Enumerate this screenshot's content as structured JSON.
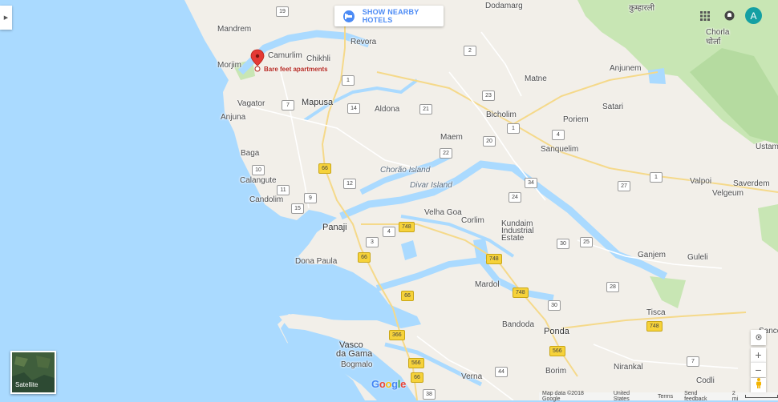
{
  "toolbar": {
    "hotel_button_label": "SHOW NEARBY HOTELS",
    "hotel_icon": "bed-icon"
  },
  "account": {
    "avatar_letter": "A",
    "apps_icon": "apps-grid-icon",
    "notifications_icon": "notifications-icon"
  },
  "layer_toggle": {
    "label": "Satellite"
  },
  "place_marker": {
    "label": "Bare feet apartments",
    "icon": "map-pin-icon"
  },
  "map_labels": {
    "dodamarg": "Dodamarg",
    "mandrem": "Mandrem",
    "morjim": "Morjim",
    "camurlim": "Camurlim",
    "chikhli": "Chikhli",
    "revora": "Revora",
    "matne": "Matne",
    "anjunem": "Anjunem",
    "chorla": "Chorla",
    "chorla_local": "चोर्ला",
    "kumbharli": "कुम्हारली",
    "vagator": "Vagator",
    "anjuna": "Anjuna",
    "mapusa": "Mapusa",
    "aldona": "Aldona",
    "bicholim": "Bicholim",
    "satari": "Satari",
    "poriem": "Poriem",
    "ustam": "Ustam",
    "baga": "Baga",
    "calangute": "Calangute",
    "candolim": "Candolim",
    "maem": "Maem",
    "sanquelim": "Sanquelim",
    "chorao_island": "Chorão Island",
    "divar_island": "Divar Island",
    "valpoi": "Valpoi",
    "saverdem": "Saverdem",
    "velgeum": "Velgeum",
    "panaji": "Panaji",
    "velha_goa": "Velha Goa",
    "corlim": "Corlim",
    "kundaim": "Kundaim",
    "industrial": "Industrial",
    "estate": "Estate",
    "dona_paula": "Dona Paula",
    "ganjem": "Ganjem",
    "guleli": "Guleli",
    "mardol": "Mardol",
    "tisca": "Tisca",
    "bandoda": "Bandoda",
    "ponda": "Ponda",
    "vasco": "Vasco",
    "da_gama": "da Gama",
    "bogmalo": "Bogmalo",
    "verna": "Verna",
    "borim": "Borim",
    "nirankal": "Nirankal",
    "codli": "Codli",
    "sanco": "Sanco"
  },
  "route_shields": {
    "s19": "19",
    "s2": "2",
    "s1a": "1",
    "s1b": "1",
    "s1c": "1",
    "s7": "7",
    "s14": "14",
    "s21": "21",
    "s23": "23",
    "s20": "20",
    "s4": "4",
    "s22": "22",
    "s10": "10",
    "s12": "12",
    "s11": "11",
    "s9": "9",
    "s15": "15",
    "s34": "34",
    "s24": "24",
    "s27": "27",
    "s4b": "4",
    "s3": "3",
    "s30a": "30",
    "s25": "25",
    "s30b": "30",
    "s28": "28",
    "s44": "44",
    "s38": "38",
    "s66a": "66",
    "s66b": "66",
    "s66c": "66",
    "s66d": "66",
    "s748a": "748",
    "s748b": "748",
    "s748c": "748",
    "s748d": "748",
    "s566a": "566",
    "s566b": "566",
    "s366": "366",
    "s7b": "7"
  },
  "footer": {
    "map_data": "Map data ©2018 Google",
    "terms_country": "United States",
    "terms": "Terms",
    "feedback": "Send feedback",
    "scale": "2 mi"
  },
  "branding": {
    "logo": "Google"
  },
  "controls": {
    "locate_icon": "my-location-icon",
    "zoom_in": "+",
    "zoom_out": "−",
    "pegman_icon": "pegman-icon"
  },
  "colors": {
    "water": "#aadaff",
    "land": "#f2efe9",
    "forest": "#c8e6b4",
    "highway": "#f6d23a",
    "accent": "#4c8bf5",
    "marker": "#e53935"
  }
}
